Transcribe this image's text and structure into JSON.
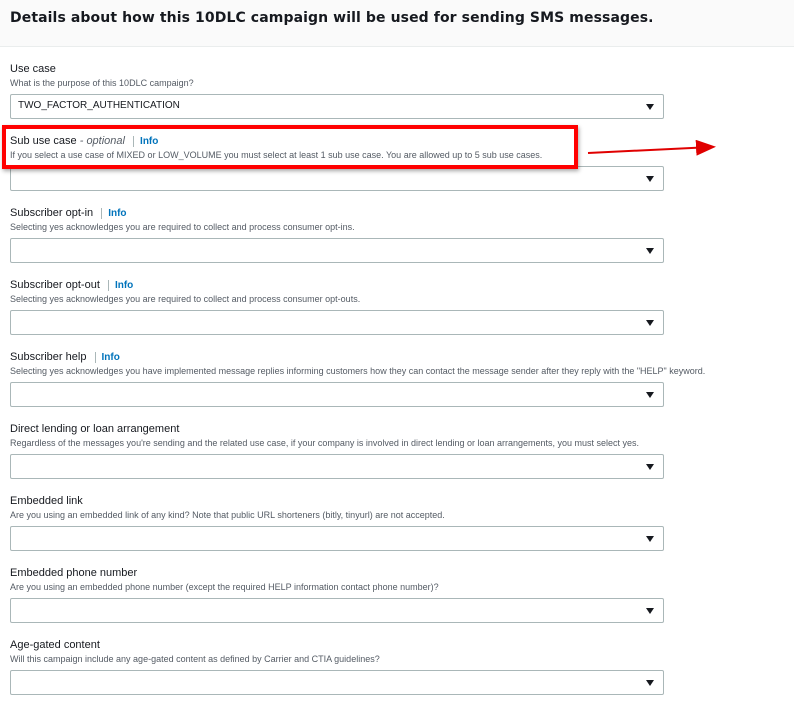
{
  "section": {
    "title": "Details about how this 10DLC campaign will be used for sending SMS messages."
  },
  "fields": [
    {
      "label": "Use case",
      "optional": "",
      "info": "",
      "description": "What is the purpose of this 10DLC campaign?",
      "value": "TWO_FACTOR_AUTHENTICATION"
    },
    {
      "label": "Sub use case",
      "optional": "- optional",
      "info": "Info",
      "description": "If you select a use case of MIXED or LOW_VOLUME you must select at least 1 sub use case. You are allowed up to 5 sub use cases.",
      "value": ""
    },
    {
      "label": "Subscriber opt-in",
      "optional": "",
      "info": "Info",
      "description": "Selecting yes acknowledges you are required to collect and process consumer opt-ins.",
      "value": ""
    },
    {
      "label": "Subscriber opt-out",
      "optional": "",
      "info": "Info",
      "description": "Selecting yes acknowledges you are required to collect and process consumer opt-outs.",
      "value": ""
    },
    {
      "label": "Subscriber help",
      "optional": "",
      "info": "Info",
      "description": "Selecting yes acknowledges you have implemented message replies informing customers how they can contact the message sender after they reply with the \"HELP\" keyword.",
      "value": ""
    },
    {
      "label": "Direct lending or loan arrangement",
      "optional": "",
      "info": "",
      "description": "Regardless of the messages you're sending and the related use case, if your company is involved in direct lending or loan arrangements, you must select yes.",
      "value": ""
    },
    {
      "label": "Embedded link",
      "optional": "",
      "info": "",
      "description": "Are you using an embedded link of any kind? Note that public URL shorteners (bitly, tinyurl) are not accepted.",
      "value": ""
    },
    {
      "label": "Embedded phone number",
      "optional": "",
      "info": "",
      "description": "Are you using an embedded phone number (except the required HELP information contact phone number)?",
      "value": ""
    },
    {
      "label": "Age-gated content",
      "optional": "",
      "info": "",
      "description": "Will this campaign include any age-gated content as defined by Carrier and CTIA guidelines?",
      "value": ""
    }
  ],
  "annotation": {
    "color": "#ff0000",
    "type": "highlight-box-with-arrow",
    "target": "Sub use case"
  },
  "colors": {
    "link": "#0073bb",
    "border": "#aab7b8",
    "text": "#16191f",
    "muted": "#545b64"
  }
}
